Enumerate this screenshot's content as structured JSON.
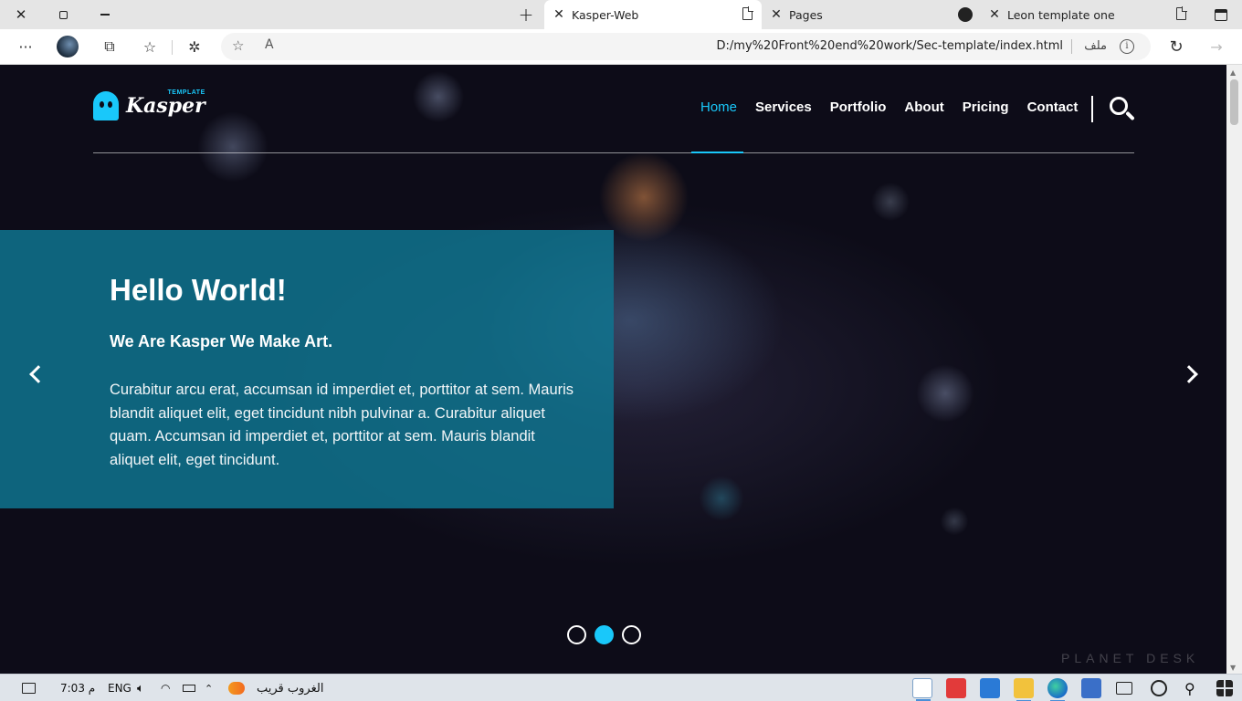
{
  "browser": {
    "tabs": [
      {
        "title": "Kasper-Web",
        "active": true
      },
      {
        "title": "Pages",
        "active": false
      },
      {
        "title": "Leon template one",
        "active": false
      }
    ],
    "address": {
      "url": "D:/my%20Front%20end%20work/Sec-template/index.html",
      "rtl_label": "ملف",
      "info_glyph": "i"
    }
  },
  "site": {
    "logo": {
      "text": "Kasper",
      "sub": "TEMPLATE",
      "accent": "#19c8fa"
    },
    "nav": [
      {
        "label": "Home",
        "active": true
      },
      {
        "label": "Services",
        "active": false
      },
      {
        "label": "Portfolio",
        "active": false
      },
      {
        "label": "About",
        "active": false
      },
      {
        "label": "Pricing",
        "active": false
      },
      {
        "label": "Contact",
        "active": false
      }
    ],
    "hero": {
      "title": "Hello World!",
      "subtitle": "We Are Kasper We Make Art.",
      "text": "Curabitur arcu erat, accumsan id imperdiet et, porttitor at sem. Mauris blandit aliquet elit, eget tincidunt nibh pulvinar a. Curabitur aliquet quam. Accumsan id imperdiet et, porttitor at sem. Mauris blandit aliquet elit, eget tincidunt."
    },
    "slider": {
      "count": 3,
      "active_index": 1
    },
    "watermark": "PLANET DESK"
  },
  "taskbar": {
    "time": "7:03 م",
    "language": "ENG",
    "weather": "الغروب قريب"
  }
}
